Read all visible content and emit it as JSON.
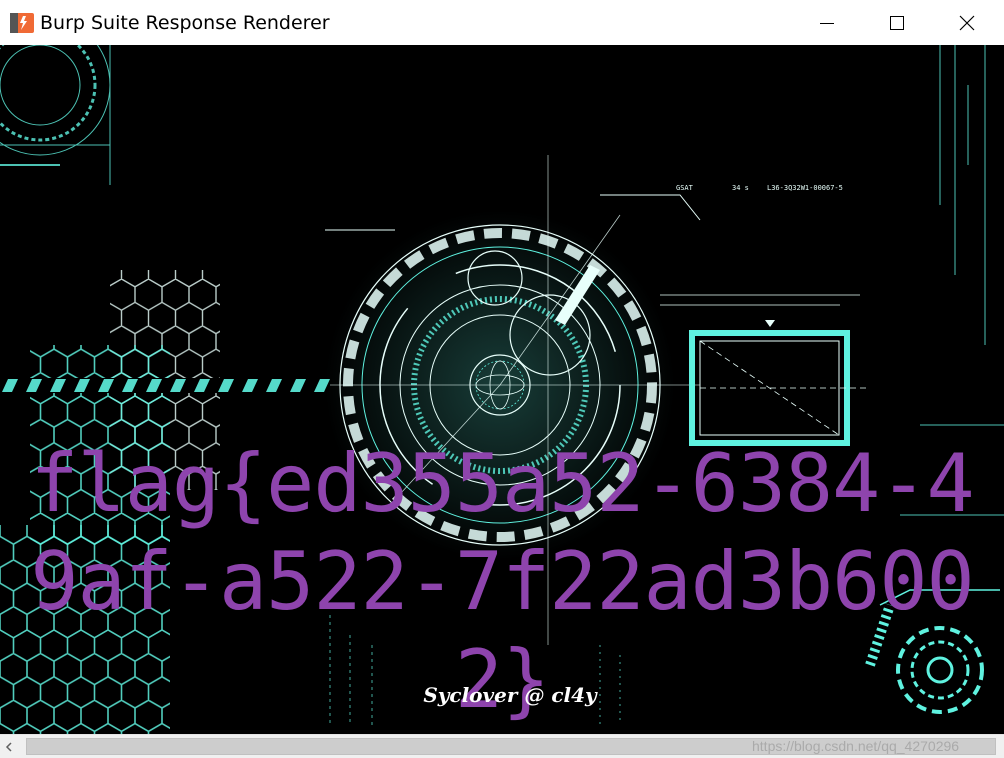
{
  "window": {
    "title": "Burp Suite Response Renderer",
    "app_icon": "burp-suite-icon",
    "controls": [
      "minimize-icon",
      "maximize-icon",
      "close-icon"
    ]
  },
  "page": {
    "flag_text": "flag{ed355a52-6384-49af-a522-7f22ad3b6002}",
    "signature": "Syclover @ cl4y",
    "hud_labels": {
      "gsat": "GSAT",
      "gsat_value": "34 s",
      "code": "L36-3Q32W1-00067-5"
    }
  },
  "scrollbar": {
    "watermark": "https://blog.csdn.net/qq_4270296"
  },
  "colors": {
    "background": "#000000",
    "flag": "#8e44ad",
    "hud_cyan": "#5ff2e0",
    "hud_white": "#e8fffb"
  }
}
